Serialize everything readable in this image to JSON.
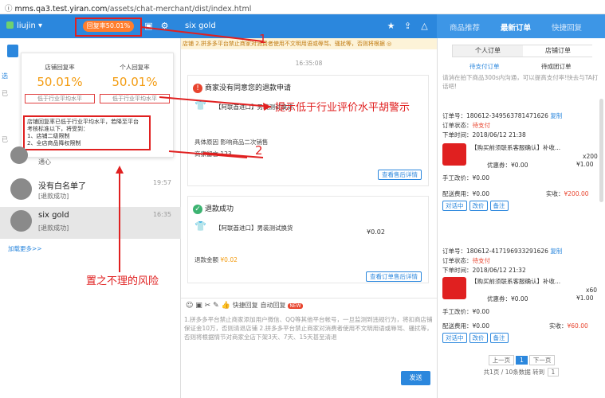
{
  "browser": {
    "info_icon": "info-icon",
    "url_host": "mms.qa3.test.yiran.com",
    "url_path": "/assets/chat-merchant/dist/index.html"
  },
  "topbar": {
    "user_name": "liujin",
    "rate_badge": "回复率50.01%",
    "chat_title": "six gold"
  },
  "right_tabs": [
    "商品推荐",
    "最新订单",
    "快捷回复"
  ],
  "popup": {
    "shop_label": "店铺回复率",
    "shop_value": "50.01%",
    "shop_compare": "低于行业平均水平",
    "personal_label": "个人回复率",
    "personal_value": "50.01%",
    "personal_compare": "低于行业平均水平",
    "warning_lines": [
      "店铺回复率已低于行业平均水平，若降至平台",
      "考核标准以下，将受到：",
      "1、店铺二级限制",
      "2、全店商品降权限制"
    ]
  },
  "left_side": {
    "label_a": "选",
    "label_b": "已",
    "label_c": "已"
  },
  "conversations": [
    {
      "name": "",
      "sub": "退款成功",
      "time": ""
    },
    {
      "name": "没有白名单了",
      "sub": "[退款成功]",
      "time": "19:57"
    },
    {
      "name": "six gold",
      "sub": "[退款成功]",
      "time": "16:35"
    }
  ],
  "partial_conv_sub": "通心",
  "load_more": "加载更多>>",
  "chat": {
    "notice": "店铺 2.拼多多平台禁止商家对消费者使用不文明用语或辱骂、骚扰等，否则将根据 ◎",
    "timestamp": "16:35:08",
    "card1": {
      "title": "商家没有同意您的退款申请",
      "product": "【阿联酋进口】男装测试换货",
      "reason_label": "具体原因",
      "reason": "影响商品二次销售",
      "note_label": "商家留言",
      "note": "123",
      "link": "查看售后详情"
    },
    "card2": {
      "title": "退款成功",
      "product": "【阿联酋进口】男装测试换货",
      "price": "¥0.02",
      "refund_label": "退款金额",
      "refund": "¥0.02",
      "link": "查看订单售后详情"
    },
    "toolbar": {
      "quick_reply": "快捷回复",
      "auto_reply": "自动回复",
      "new_badge": "NEW"
    },
    "input_text": "1.拼多多平台禁止商家添加用户微信、QQ等其他平台帐号，一旦监测到违规行为，将扣商店铺保证金10万，否则清退店铺 2.拼多多平台禁止商家对消费者使用不文明用语或辱骂、骚扰等，否则将根据情节对商家全店下架3天、7天、15天甚至清退",
    "send": "发送"
  },
  "orders": {
    "tab_personal": "个人订单",
    "tab_shop": "店铺订单",
    "sub_unpaid": "待支付订单",
    "sub_group": "待成团订单",
    "note": "请消在拍下商品300s内沟通，可以提高支付率!快去与TA打话吧!",
    "list": [
      {
        "no_label": "订单号：",
        "no": "180612-349563781471626",
        "copy": "复制",
        "status_label": "订单状态：",
        "status": "待支付",
        "time_label": "下单时间：",
        "time": "2018/06/12 21:38",
        "title": "【购买前须联系客服确认】补收...",
        "qty": "x200",
        "discount": "优惠券：¥0.00",
        "price": "¥1.00",
        "fee": "手工改价：¥0.00",
        "ship": "配送费用：¥0.00",
        "paid_label": "实收：",
        "paid": "¥200.00"
      },
      {
        "no_label": "订单号：",
        "no": "180612-417196933291626",
        "copy": "复制",
        "status_label": "订单状态：",
        "status": "待支付",
        "time_label": "下单时间：",
        "time": "2018/06/12 21:32",
        "title": "【购买前须联系客服确认】补收...",
        "qty": "x60",
        "discount": "优惠券：¥0.00",
        "price": "¥1.00",
        "fee": "手工改价：¥0.00",
        "ship": "配送费用：¥0.00",
        "paid_label": "实收：",
        "paid": "¥60.00"
      }
    ],
    "btn_chat": "对话中",
    "btn_edit": "改价",
    "btn_note": "备注",
    "pager": {
      "prev": "上一页",
      "page": "1",
      "next": "下一页",
      "summary": "共1页 / 10条数据 转到",
      "goto": "1"
    }
  },
  "annotations": {
    "num1": "1",
    "num2": "2",
    "text_warning": "提示低于行业评价水平胡警示",
    "text_risk": "置之不理的风险"
  }
}
